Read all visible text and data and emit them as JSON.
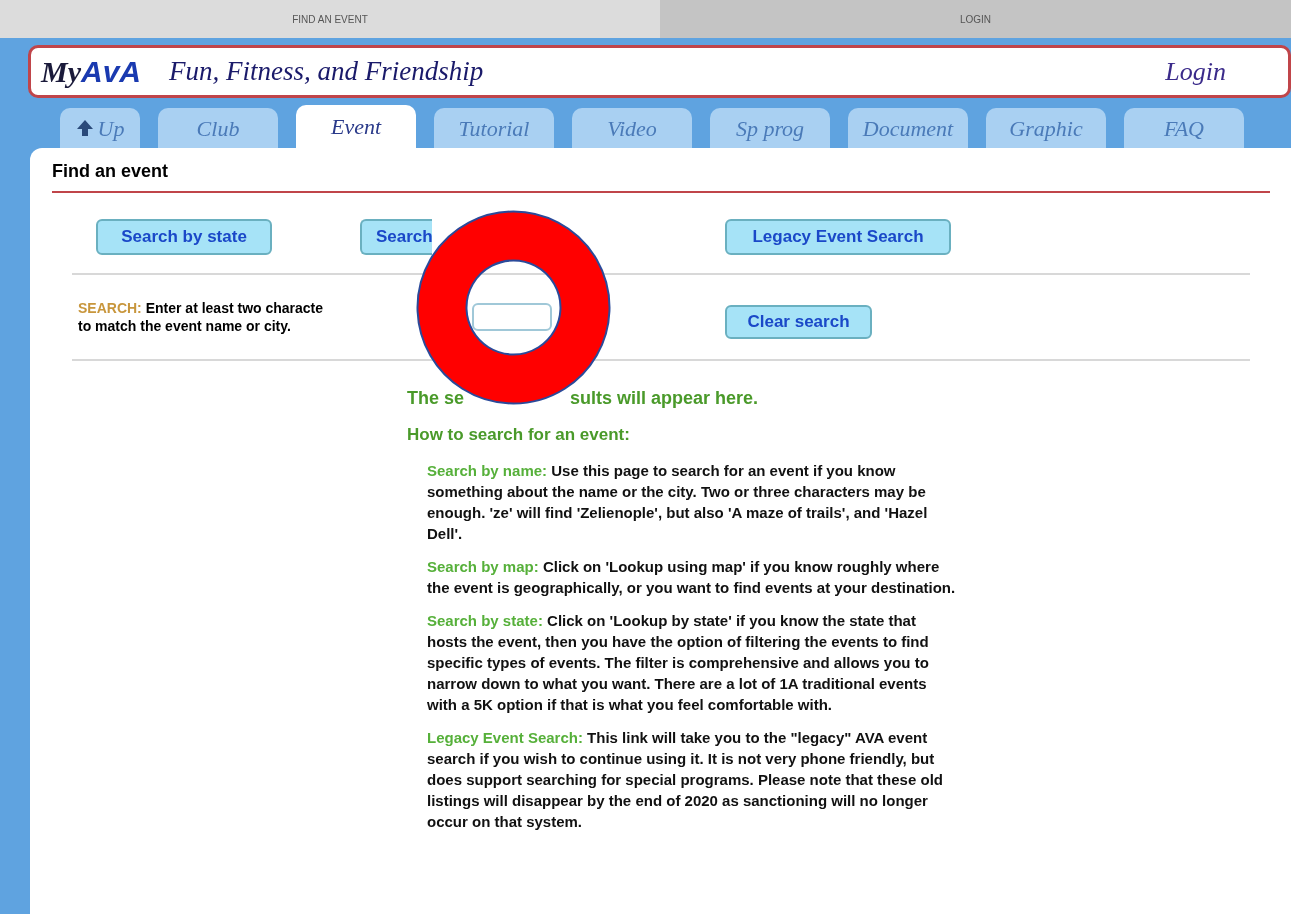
{
  "top_bar": [
    {
      "label": "FIND AN EVENT",
      "selected": true
    },
    {
      "label": "LOGIN",
      "selected": false
    }
  ],
  "header": {
    "logo": {
      "prefix": "My",
      "mark": "AvA"
    },
    "tagline": "Fun, Fitness, and Friendship",
    "login": "Login"
  },
  "tabs": [
    {
      "label": "Up",
      "selected": false,
      "kind": "up"
    },
    {
      "label": "Club",
      "selected": false,
      "kind": "tab"
    },
    {
      "label": "Event",
      "selected": true,
      "kind": "tab"
    },
    {
      "label": "Tutorial",
      "selected": false,
      "kind": "tab"
    },
    {
      "label": "Video",
      "selected": false,
      "kind": "tab"
    },
    {
      "label": "Sp prog",
      "selected": false,
      "kind": "tab"
    },
    {
      "label": "Document",
      "selected": false,
      "kind": "tab"
    },
    {
      "label": "Graphic",
      "selected": false,
      "kind": "tab"
    },
    {
      "label": "FAQ",
      "selected": false,
      "kind": "tab"
    }
  ],
  "page_title": "Find an event",
  "search_buttons": [
    "Search by state",
    "Search",
    "Legacy Event Search"
  ],
  "search": {
    "label": "SEARCH:",
    "lines": [
      "Enter at least two characte",
      "to match the event name or city."
    ],
    "clear_button": "Clear search"
  },
  "results": [
    "The se",
    "sults will appear here."
  ],
  "help_title": "How to search for an event:",
  "help": [
    {
      "label": "Search by name:",
      "text": "Use this page to search for an event if you know something about the name or the city. Two or three characters may be enough. 'ze' will find 'Zelienople', but also 'A maze of trails', and 'Hazel Dell'."
    },
    {
      "label": "Search by map:",
      "text": "Click on 'Lookup using map' if you know roughly where the event is geographically, or you want to find events at your destination."
    },
    {
      "label": "Search by state:",
      "text": "Click on 'Lookup by state' if you know the state that hosts the event, then you have the option of filtering the events to find specific types of events. The filter is comprehensive and allows you to narrow down to what you want. There are a lot of 1A traditional events with a 5K option if that is what you feel comfortable with."
    },
    {
      "label": "Legacy Event Search:",
      "text": "This link will take you to the \"legacy\" AVA event search if you wish to continue using it. It is not very phone friendly, but does support searching for special programs. Please note that these old listings will disappear by the end of 2020 as sanctioning will no longer occur on that system."
    }
  ]
}
